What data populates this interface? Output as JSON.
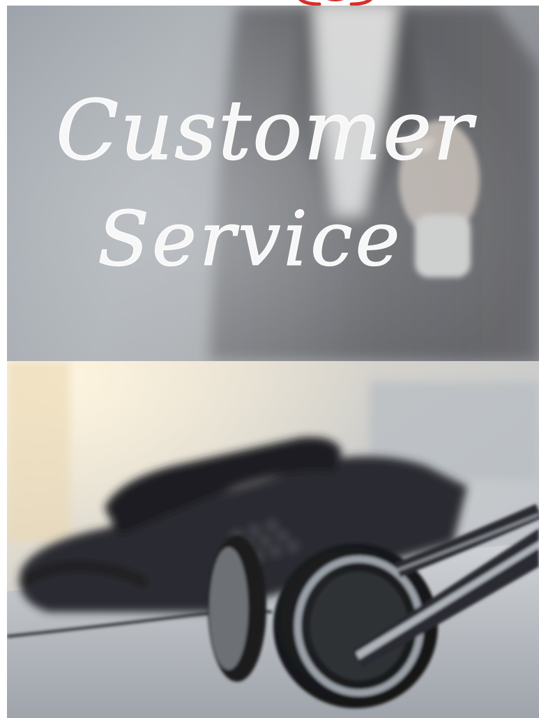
{
  "photos": [
    {
      "subject": "person in dark suit writing on glass",
      "handwritten_text": {
        "line1": "Customer",
        "line2": "Service"
      }
    },
    {
      "subject": "desk telephone with headset in foreground"
    }
  ],
  "colors": {
    "logo_red": "#d4302c",
    "glass_gray": "#a9adb2",
    "suit_dark": "#4e4f52",
    "desk_light": "#d9dbde",
    "phone_black": "#1f2125"
  }
}
